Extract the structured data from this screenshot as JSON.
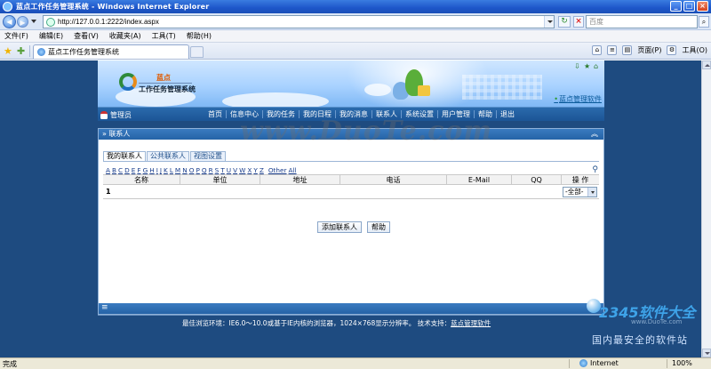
{
  "browser": {
    "title": "蓝点工作任务管理系统 - Windows Internet Explorer",
    "url": "http://127.0.0.1:2222/index.aspx",
    "search_placeholder": "百度",
    "menu": [
      "文件(F)",
      "编辑(E)",
      "查看(V)",
      "收藏夹(A)",
      "工具(T)",
      "帮助(H)"
    ],
    "tab_title": "蓝点工作任务管理系统",
    "commands": {
      "page": "页面(P)",
      "tools": "工具(O)"
    },
    "status": {
      "left": "完成",
      "zone": "Internet",
      "zoom": "100%"
    }
  },
  "site": {
    "brand_top": "蓝点",
    "brand_name": "工作任务管理系统",
    "banner_link": "蓝点管理软件",
    "user": "管理员",
    "nav": [
      "首页",
      "信息中心",
      "我的任务",
      "我的日程",
      "我的消息",
      "联系人",
      "系统设置",
      "用户管理",
      "帮助",
      "退出"
    ]
  },
  "panel": {
    "title": "» 联系人",
    "tabs": [
      "我的联系人",
      "公共联系人",
      "视图设置"
    ],
    "letters": [
      "A",
      "B",
      "C",
      "D",
      "E",
      "F",
      "G",
      "H",
      "I",
      "J",
      "K",
      "L",
      "M",
      "N",
      "O",
      "P",
      "Q",
      "R",
      "S",
      "T",
      "U",
      "V",
      "W",
      "X",
      "Y",
      "Z"
    ],
    "other": "Other",
    "all": "All",
    "columns": [
      "名称",
      "单位",
      "地址",
      "电话",
      "E-Mail",
      "QQ",
      "操 作"
    ],
    "row_number": "1",
    "select_value": "-全部-",
    "buttons": {
      "add": "添加联系人",
      "help": "帮助"
    }
  },
  "footer": {
    "text": "最佳浏览环境：IE6.0～10.0或基于IE内核的浏览器，1024×768显示分辨率。  技术支持：",
    "link": "蓝点管理软件"
  },
  "overlay": {
    "watermark": "www.DuoTe.com",
    "corner_big": "2345软件大全",
    "corner_small": "www.DuoTe.com",
    "corner_cn": "国内最安全的软件站"
  },
  "colors": {
    "page_bg": "#1e4b80",
    "nav_bg": "#1c5596",
    "accent": "#2563a7"
  }
}
